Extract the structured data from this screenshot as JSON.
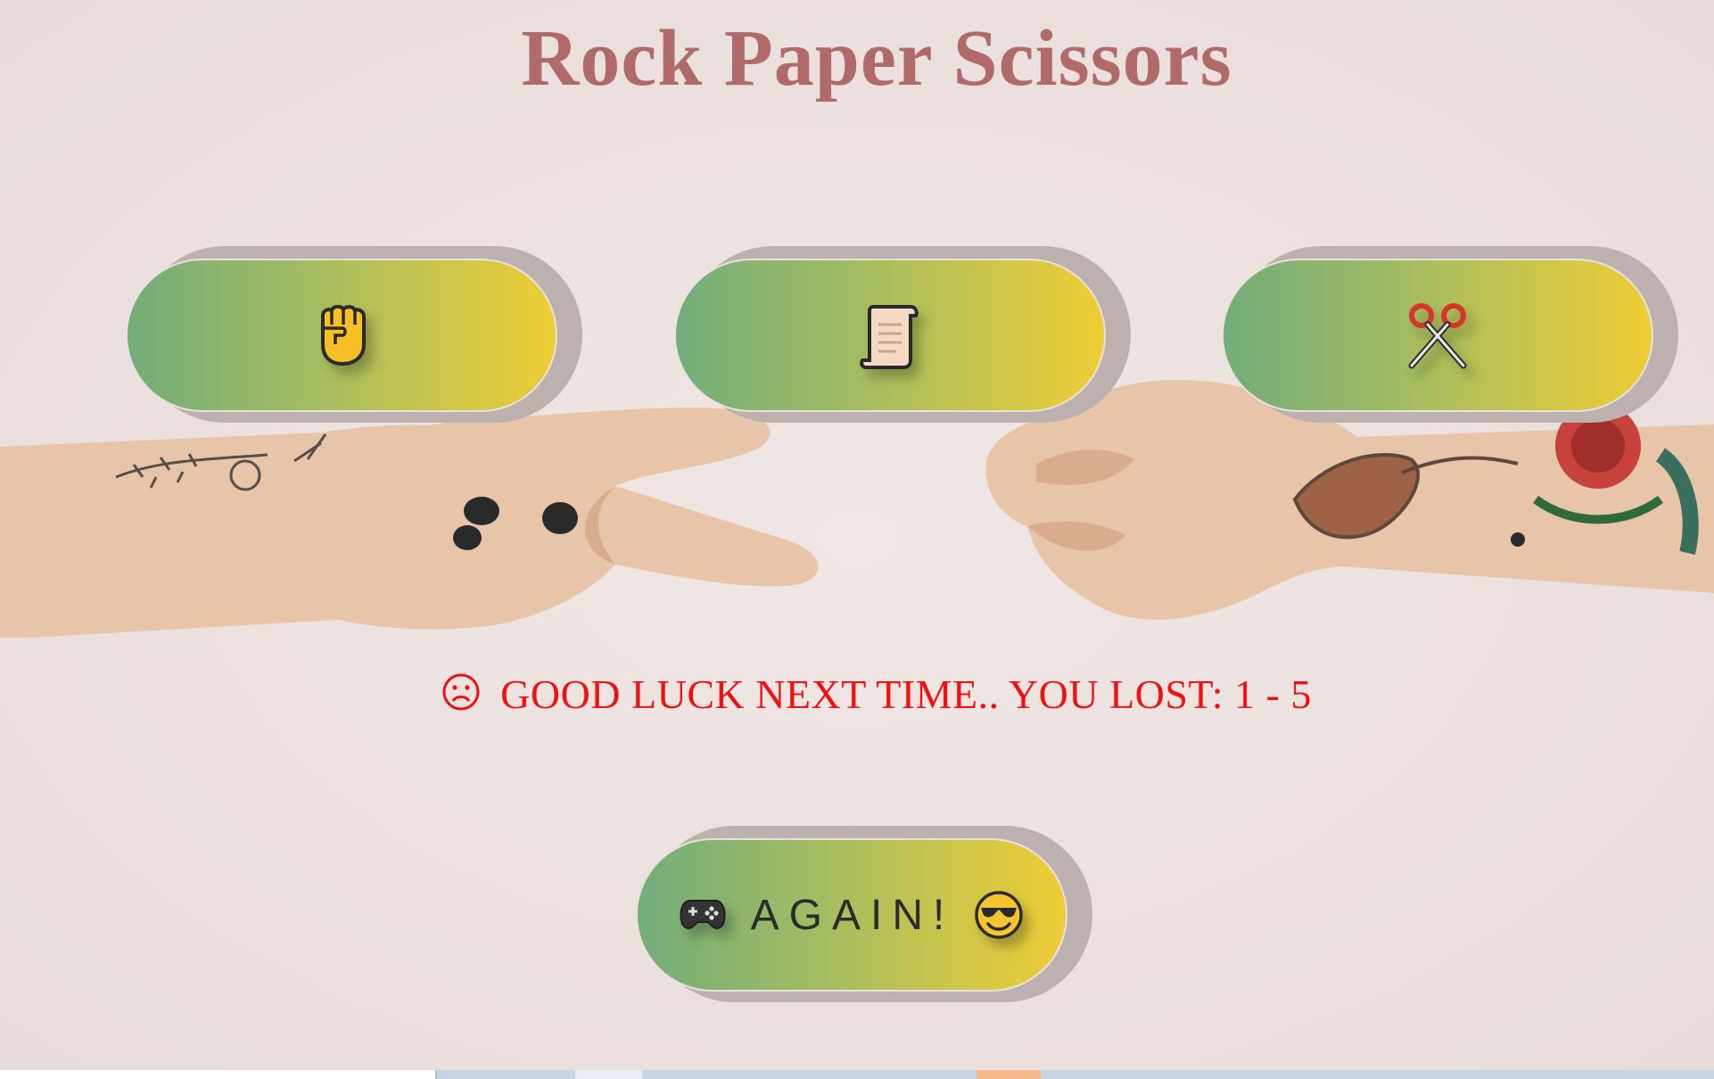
{
  "title": "Rock Paper Scissors",
  "choices": [
    {
      "name": "rock",
      "icon": "raised-fist-icon"
    },
    {
      "name": "paper",
      "icon": "scroll-icon"
    },
    {
      "name": "scissors",
      "icon": "scissors-icon"
    }
  ],
  "result": {
    "icon": "frowning-face-icon",
    "text": "GOOD LUCK NEXT TIME.. YOU LOST: 1 - 5",
    "color": "#ef1010"
  },
  "again_button": {
    "left_icon": "game-controller-icon",
    "label": "AGAIN!",
    "right_icon": "smiling-face-with-sunglasses-icon"
  },
  "colors": {
    "title": "#b06a6a",
    "button_gradient_start": "#72ad7a",
    "button_gradient_end": "#efcd35",
    "background": "#ece2e0"
  }
}
